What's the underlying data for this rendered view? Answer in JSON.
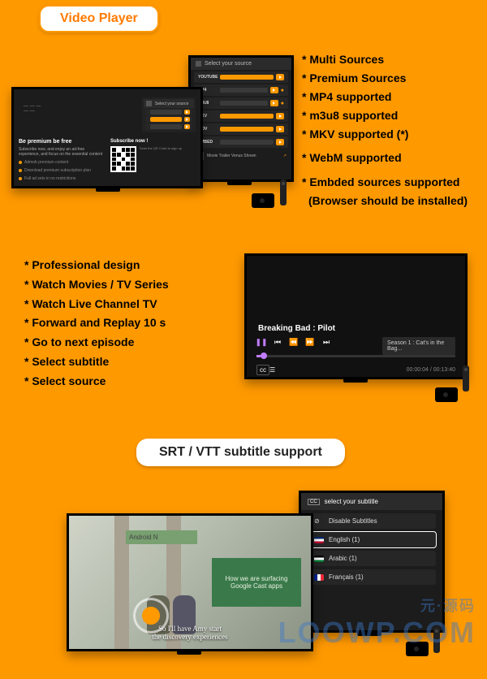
{
  "header": {
    "tab_label": "Video Player"
  },
  "sources_panel": {
    "select_label": "Select your source",
    "items": [
      "YOUTUBE",
      "MP4",
      "M3U8",
      "MKV",
      "MOV",
      "EMBED"
    ],
    "movie_trailer": "Movie Trailer Venus Shown"
  },
  "premium": {
    "title": "Be premium be free",
    "blurb": "Subscribe now, and enjoy an ad-free experience, and focus on the essential content",
    "opt1": "Admob premium content",
    "opt2": "Download premium subscription plan",
    "opt3": "Full ad sets in no restrictions",
    "sub_title": "Subscribe now !",
    "sub_blurb": "Scan the QR Code to sign up"
  },
  "features_right": {
    "l1": "* Multi Sources",
    "l2": "* Premium Sources",
    "l3": "* MP4 supported",
    "l4": "* m3u8 supported",
    "l5": "* MKV supported (*)",
    "l6": "* WebM supported",
    "l7": "* Embded sources supported",
    "l7b": "  (Browser should be installed)"
  },
  "features_left": {
    "l1": "* Professional design",
    "l2": "* Watch Movies / TV Series",
    "l3": "* Watch Live Channel TV",
    "l4": "* Forward and Replay 10 s",
    "l5": "* Go to next episode",
    "l6": "* Select subtitle",
    "l7": "* Select source"
  },
  "player": {
    "title": "Breaking Bad : Pilot",
    "season_btn": "Season 1 : Cat's in the Bag...",
    "cc": "cc",
    "time": "00:00:04 / 00:13:40"
  },
  "subtitle_section": {
    "badge": "SRT / VTT subtitle support",
    "select_label": "select your subtitle",
    "disable": "Disable Subtitles",
    "english": "English (1)",
    "arabic": "Arabic (1)",
    "french": "Français (1)"
  },
  "photo": {
    "sign": "Android N",
    "board": "How we are surfacing Google Cast apps",
    "caption1": "So I'll have Amy start",
    "caption2": "the discovery experiences"
  },
  "watermark": {
    "cn": "元·源码",
    "en": "LOOWP.COM"
  }
}
